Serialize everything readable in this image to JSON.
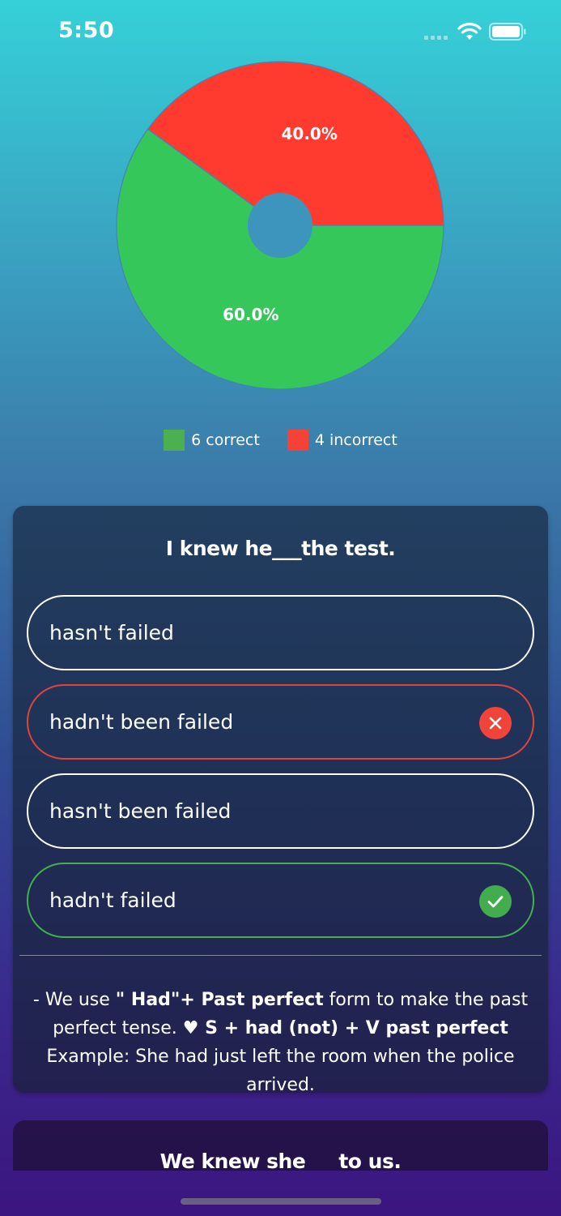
{
  "status_bar": {
    "time": "5:50",
    "icons": [
      "signal-icon",
      "wifi-icon",
      "battery-icon"
    ]
  },
  "chart_data": {
    "type": "pie",
    "donut": true,
    "slices": [
      {
        "label": "60.0%",
        "value": 60.0,
        "color": "#35c759"
      },
      {
        "label": "40.0%",
        "value": 40.0,
        "color": "#ff3b30"
      }
    ],
    "legend": [
      {
        "text": "6 correct",
        "count": 6,
        "color": "#4cb050"
      },
      {
        "text": "4 incorrect",
        "count": 4,
        "color": "#f44336"
      }
    ],
    "legend_position": "bottom-center"
  },
  "quiz": {
    "question": "I knew he___the test.",
    "options": [
      {
        "label": "hasn't failed",
        "state": "default"
      },
      {
        "label": "hadn't been failed",
        "state": "wrong",
        "icon": "close-icon"
      },
      {
        "label": "hasn't been failed",
        "state": "default"
      },
      {
        "label": "hadn't failed",
        "state": "right",
        "icon": "check-icon"
      }
    ],
    "explanation": {
      "p1": "- We use ",
      "b1": "\" Had\"+ Past perfect",
      "p2": " form to make the past perfect tense. ",
      "b2": "♥ S + had (not) + V past perfect",
      "p3": " Example: She had just left the room when the police arrived."
    }
  },
  "next_question": {
    "question": "We knew she     to us."
  },
  "colors": {
    "correct": "#44b04f",
    "incorrect": "#f0443a"
  }
}
